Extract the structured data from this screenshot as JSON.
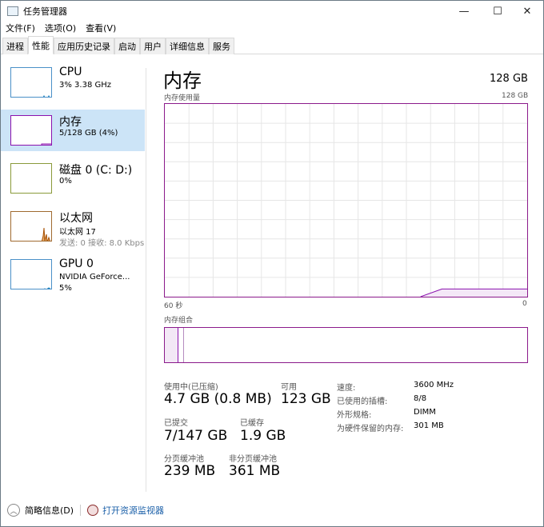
{
  "window": {
    "title": "任务管理器",
    "minimize": "—",
    "maximize": "☐",
    "close": "✕"
  },
  "menu": [
    "文件(F)",
    "选项(O)",
    "查看(V)"
  ],
  "tabs": [
    {
      "label": "进程"
    },
    {
      "label": "性能",
      "active": true
    },
    {
      "label": "应用历史记录"
    },
    {
      "label": "启动"
    },
    {
      "label": "用户"
    },
    {
      "label": "详细信息"
    },
    {
      "label": "服务"
    }
  ],
  "sidebar": [
    {
      "name": "CPU",
      "line2": "3% 3.38 GHz",
      "color": "#117dbb"
    },
    {
      "name": "内存",
      "line2": "5/128 GB (4%)",
      "color": "#8b12ae",
      "selected": true
    },
    {
      "name": "磁盘 0 (C: D:)",
      "line2": "0%",
      "color": "#4da60c"
    },
    {
      "name": "以太网",
      "line2": "以太网 17",
      "line3": "发送: 0 接收: 8.0 Kbps",
      "color": "#a74f01"
    },
    {
      "name": "GPU 0",
      "line2": "NVIDIA GeForce...",
      "line3": "5%",
      "color": "#117dbb"
    }
  ],
  "main": {
    "title": "内存",
    "capacity": "128 GB",
    "usage_label": "内存使用量",
    "usage_max": "128 GB",
    "time_left": "60 秒",
    "time_right": "0",
    "composition_label": "内存组合",
    "usage_percent_recent": [
      0,
      0,
      0,
      0,
      0,
      0,
      0,
      0,
      0,
      0,
      0,
      0,
      0,
      4,
      4,
      4,
      4,
      4
    ],
    "stats": {
      "in_use_label": "使用中(已压缩)",
      "in_use": "4.7 GB (0.8 MB)",
      "available_label": "可用",
      "available": "123 GB",
      "committed_label": "已提交",
      "committed": "7/147 GB",
      "cached_label": "已缓存",
      "cached": "1.9 GB",
      "paged_label": "分页缓冲池",
      "paged": "239 MB",
      "nonpaged_label": "非分页缓冲池",
      "nonpaged": "361 MB"
    },
    "details": [
      {
        "k": "速度:",
        "v": "3600 MHz"
      },
      {
        "k": "已使用的插槽:",
        "v": "8/8"
      },
      {
        "k": "外形规格:",
        "v": "DIMM"
      },
      {
        "k": "为硬件保留的内存:",
        "v": "301 MB"
      }
    ]
  },
  "footer": {
    "fewer_details": "简略信息(D)",
    "resource_monitor": "打开资源监视器"
  }
}
